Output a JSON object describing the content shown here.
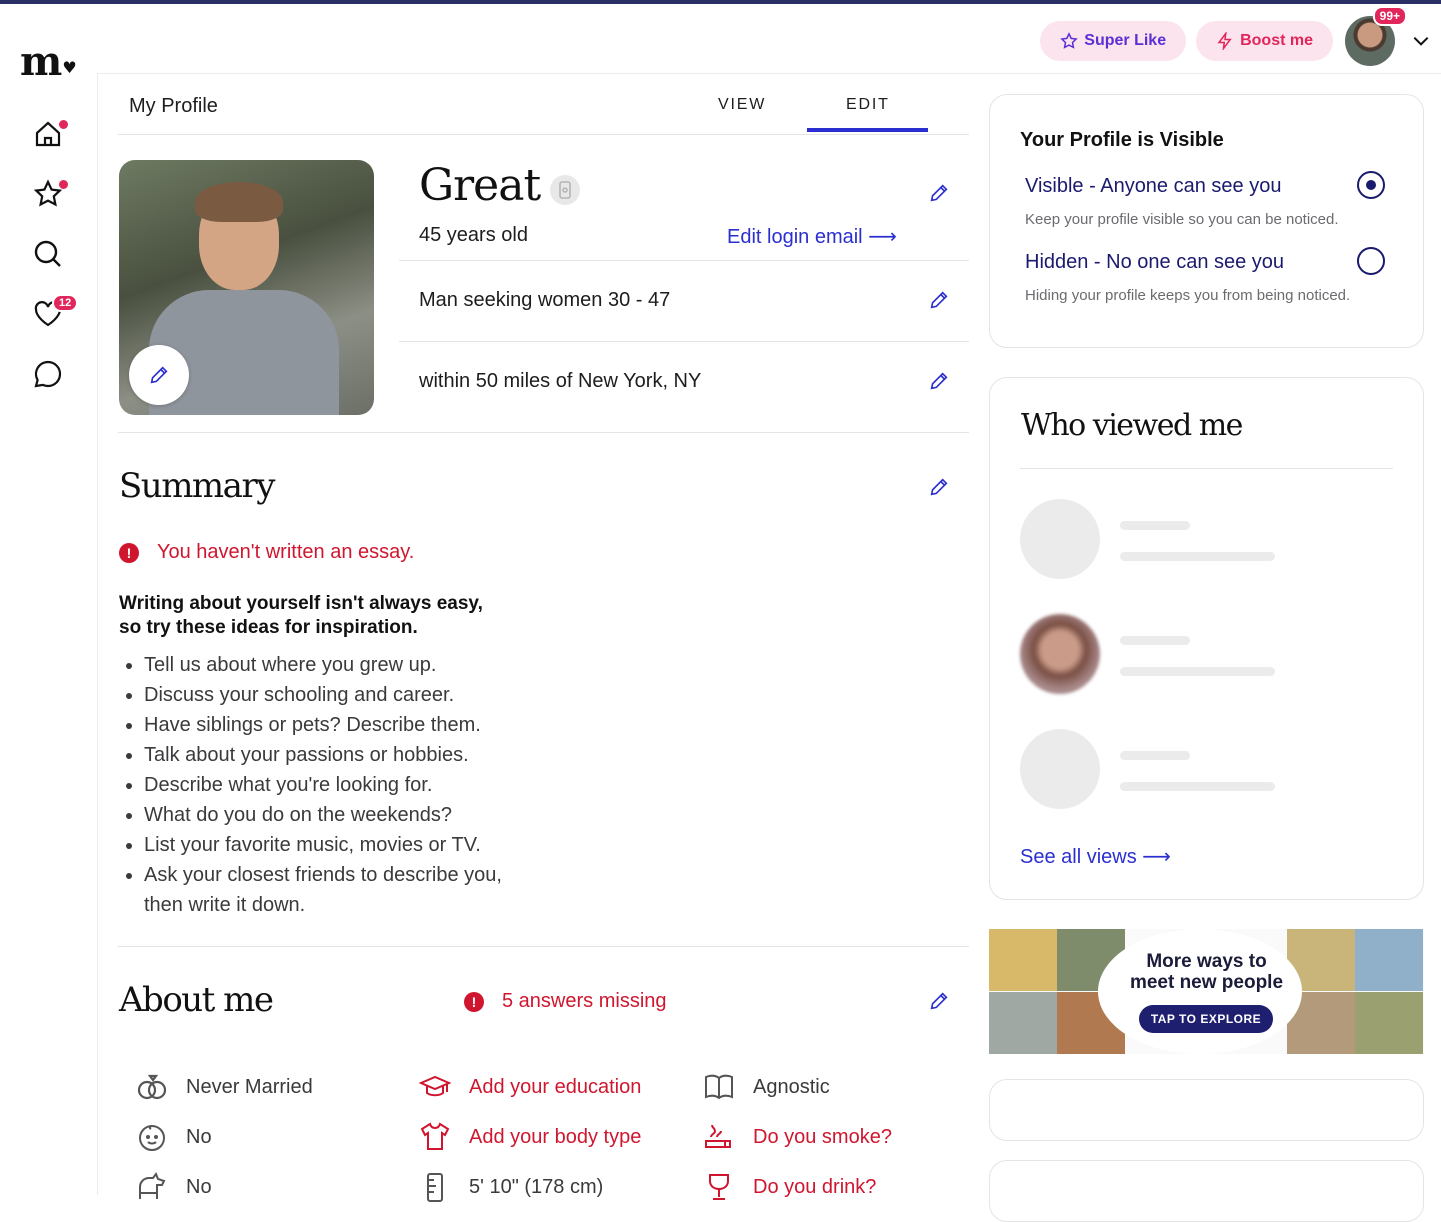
{
  "brand": {
    "logo_text": "m",
    "logo_heart": "♥",
    "accent_blue": "#2b2fd0",
    "alert_red": "#d0162f",
    "navy": "#1a1a6e"
  },
  "header": {
    "super_like_label": "Super Like",
    "boost_label": "Boost me",
    "notifications_badge": "99+"
  },
  "sidenav": {
    "items": [
      {
        "icon": "home-icon",
        "has_dot": true
      },
      {
        "icon": "star-icon",
        "has_dot": true
      },
      {
        "icon": "search-icon",
        "has_dot": false
      },
      {
        "icon": "heart-icon",
        "count": "12"
      },
      {
        "icon": "chat-icon",
        "has_dot": false
      }
    ]
  },
  "main": {
    "page_title": "My Profile",
    "tabs": [
      {
        "label": "VIEW"
      },
      {
        "label": "EDIT",
        "active": true
      }
    ],
    "profile": {
      "name": "Great",
      "age": "45 years old",
      "edit_login_email": "Edit login email",
      "seeking": "Man seeking women 30 - 47",
      "location": "within 50 miles of New York, NY"
    },
    "summary": {
      "title": "Summary",
      "warning": "You haven't written an essay.",
      "ideas_heading_line1": "Writing about yourself isn't always easy,",
      "ideas_heading_line2": "so try these ideas for inspiration.",
      "ideas": [
        "Tell us about where you grew up.",
        "Discuss your schooling and career.",
        "Have siblings or pets? Describe them.",
        "Talk about your passions or hobbies.",
        "Describe what you're looking for.",
        "What do you do on the weekends?",
        "List your favorite music, movies or TV.",
        "Ask your closest friends to describe you, then write it down."
      ]
    },
    "about": {
      "title": "About me",
      "warning": "5 answers missing",
      "attributes": [
        {
          "icon": "rings-icon",
          "text": "Never Married",
          "missing": false
        },
        {
          "icon": "graduation-cap-icon",
          "text": "Add your education",
          "missing": true
        },
        {
          "icon": "book-icon",
          "text": "Agnostic",
          "missing": false
        },
        {
          "icon": "baby-icon",
          "text": "No",
          "missing": false
        },
        {
          "icon": "shirt-icon",
          "text": "Add your body type",
          "missing": true
        },
        {
          "icon": "smoking-icon",
          "text": "Do you smoke?",
          "missing": true
        },
        {
          "icon": "pet-icon",
          "text": "No",
          "missing": false
        },
        {
          "icon": "ruler-icon",
          "text": "5' 10\" (178 cm)",
          "missing": false
        },
        {
          "icon": "wine-glass-icon",
          "text": "Do you drink?",
          "missing": true
        }
      ]
    }
  },
  "visibility": {
    "title": "Your Profile is Visible",
    "options": [
      {
        "label": "Visible - Anyone can see you",
        "description": "Keep your profile visible so you can be noticed.",
        "selected": true
      },
      {
        "label": "Hidden - No one can see you",
        "description": "Hiding your profile keeps you from being noticed.",
        "selected": false
      }
    ]
  },
  "who_viewed": {
    "title": "Who viewed me",
    "see_all": "See all views"
  },
  "promo": {
    "line1": "More ways to",
    "line2": "meet new people",
    "button": "TAP TO EXPLORE"
  }
}
